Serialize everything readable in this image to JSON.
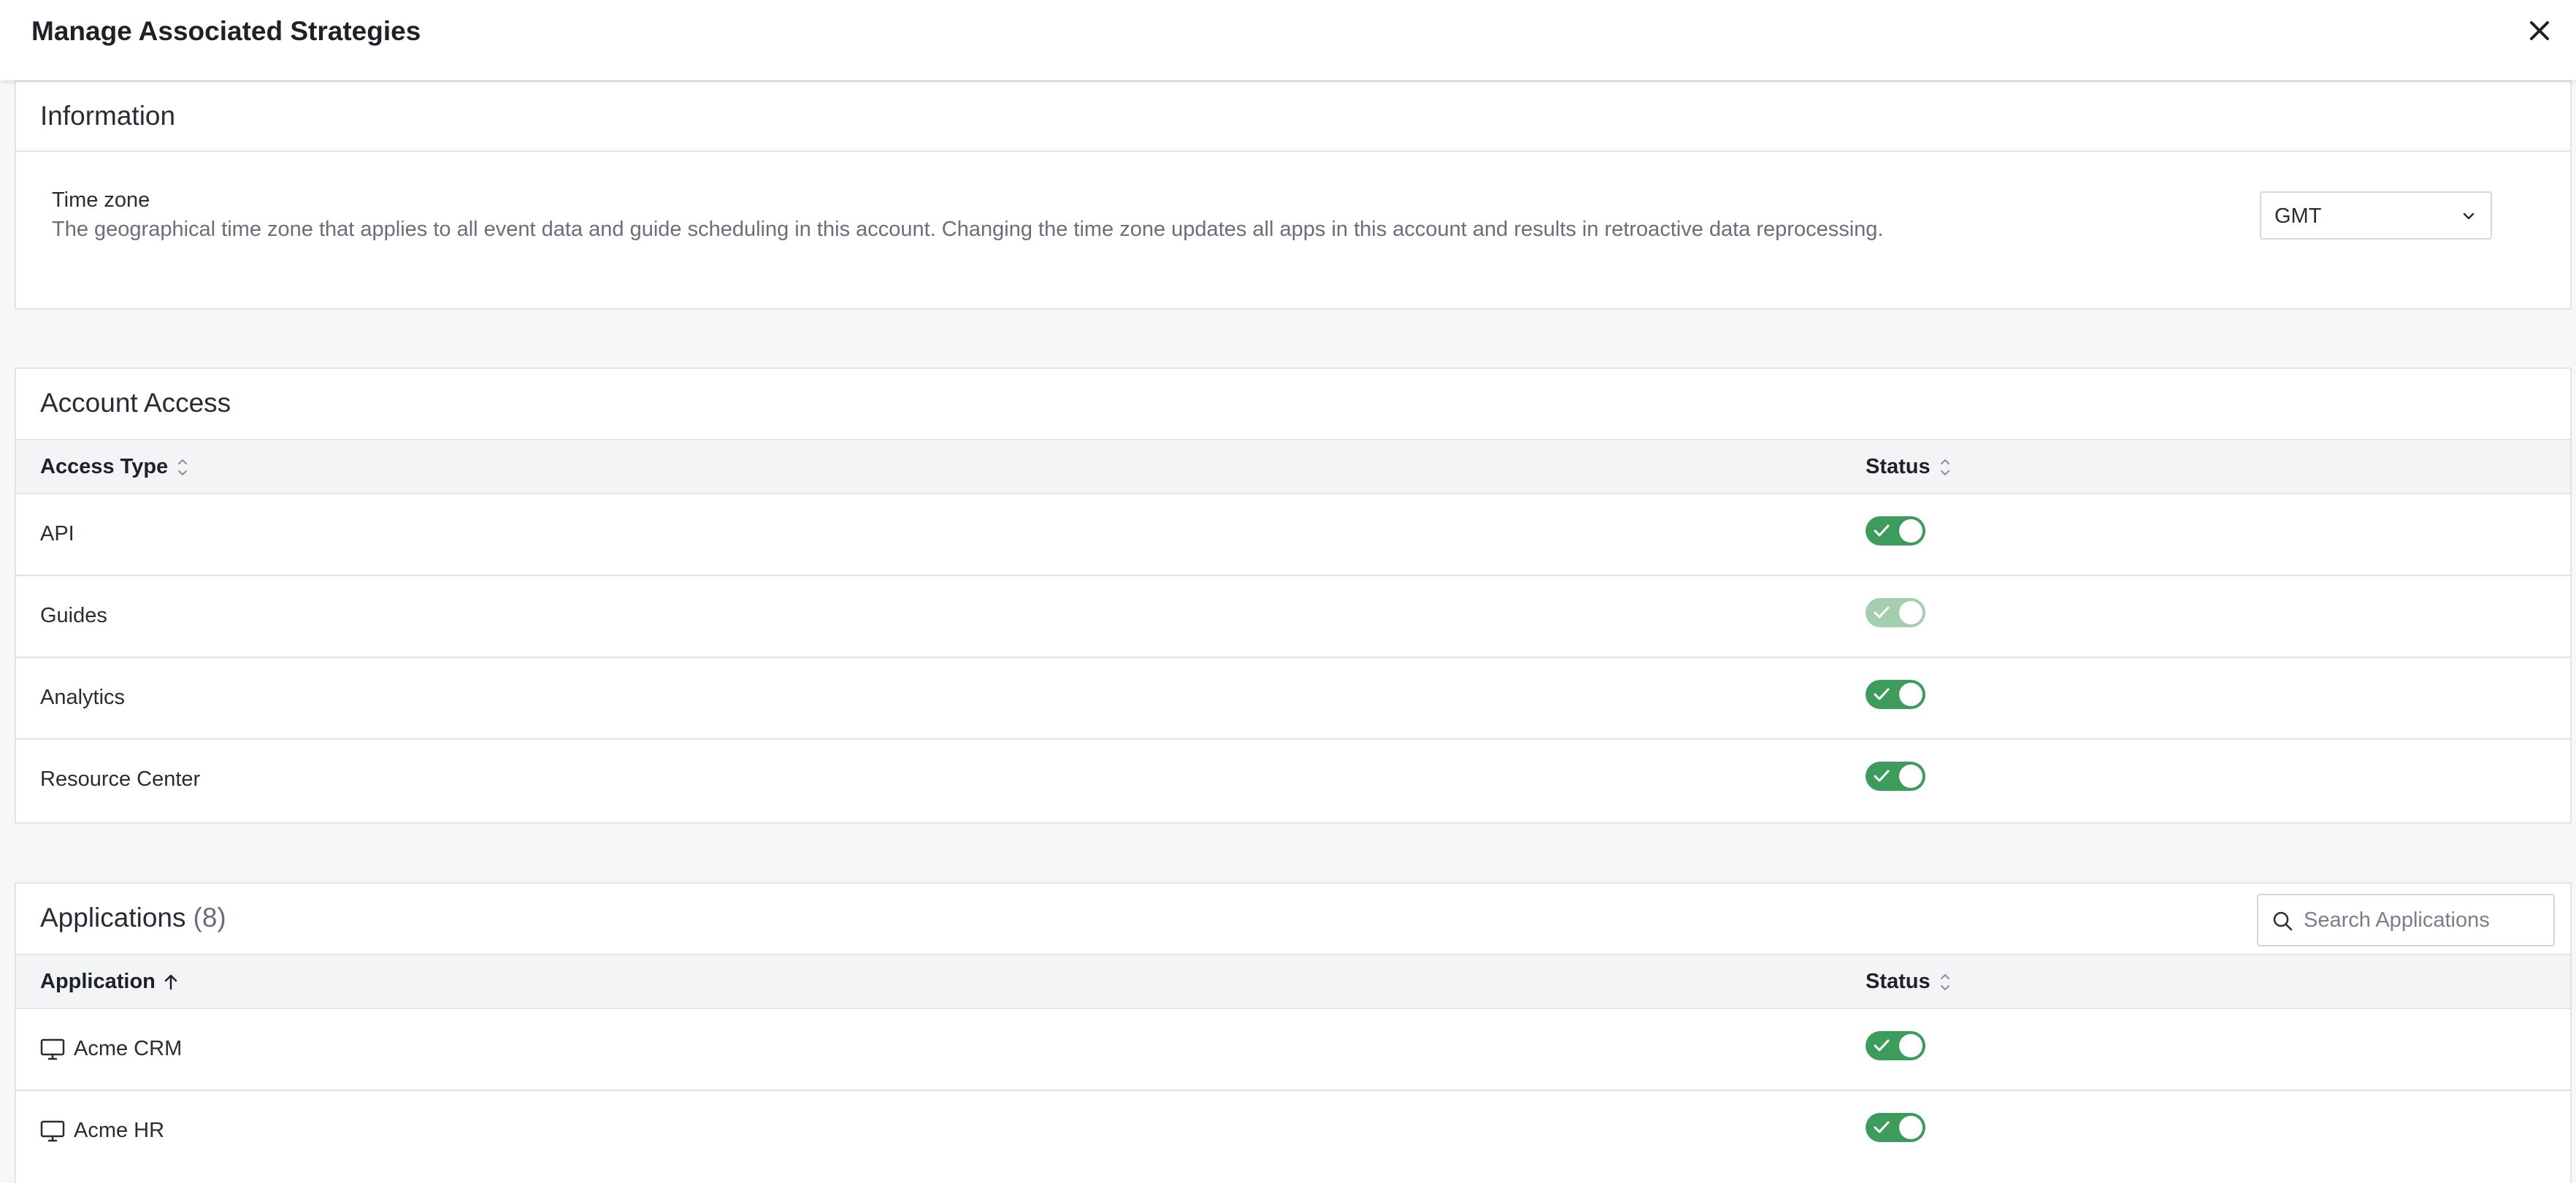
{
  "dialog": {
    "title": "Manage Associated Strategies"
  },
  "information": {
    "title": "Information",
    "timezone_label": "Time zone",
    "timezone_description": "The geographical time zone that applies to all event data and guide scheduling in this account. Changing the time zone updates all apps in this account and results in retroactive data reprocessing.",
    "timezone_value": "GMT"
  },
  "account_access": {
    "title": "Account Access",
    "columns": {
      "type": "Access Type",
      "status": "Status"
    },
    "rows": [
      {
        "name": "API",
        "enabled": true,
        "disabled": false
      },
      {
        "name": "Guides",
        "enabled": true,
        "disabled": true
      },
      {
        "name": "Analytics",
        "enabled": true,
        "disabled": false
      },
      {
        "name": "Resource Center",
        "enabled": true,
        "disabled": false
      }
    ]
  },
  "applications": {
    "title": "Applications",
    "count": "(8)",
    "search_placeholder": "Search Applications",
    "columns": {
      "application": "Application",
      "status": "Status"
    },
    "rows": [
      {
        "name": "Acme CRM",
        "icon": "desktop-icon",
        "enabled": true
      },
      {
        "name": "Acme HR",
        "icon": "desktop-icon",
        "enabled": true
      }
    ]
  },
  "colors": {
    "toggle_on": "#3d9b5c",
    "toggle_disabled": "#a3cfb0"
  }
}
